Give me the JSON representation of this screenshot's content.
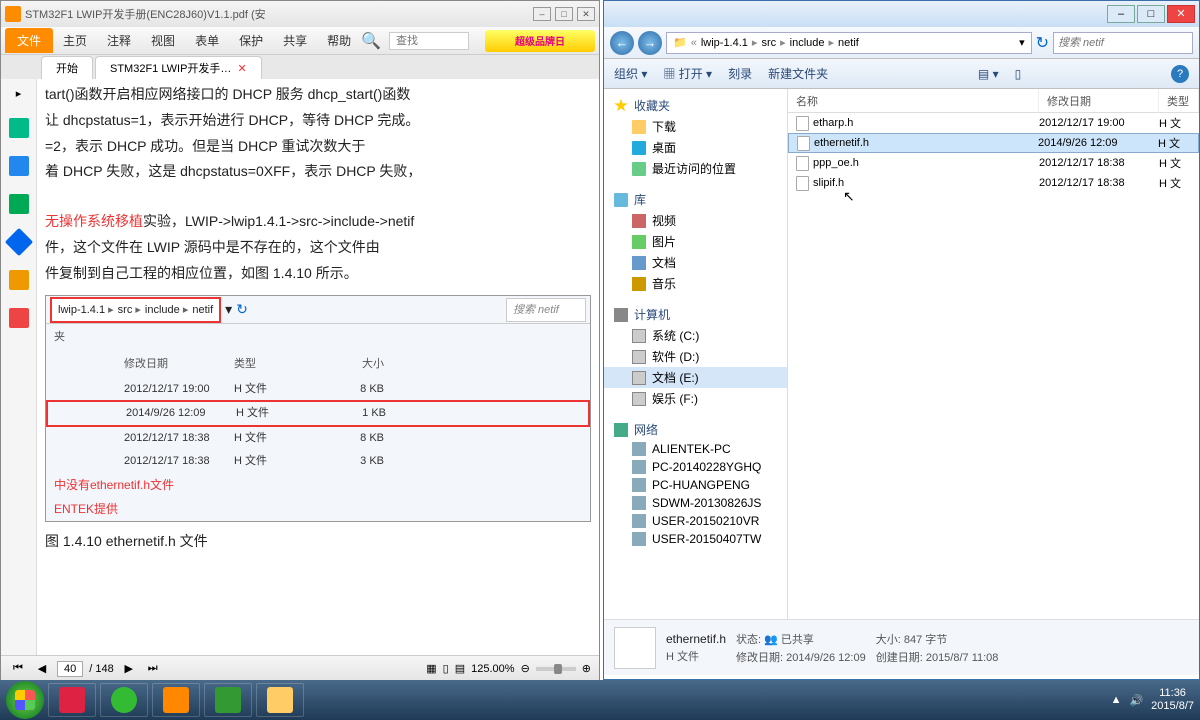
{
  "pdf": {
    "title": "STM32F1 LWIP开发手册(ENC28J60)V1.1.pdf (安",
    "menu": {
      "file": "文件",
      "home": "主页",
      "comment": "注释",
      "view": "视图",
      "form": "表单",
      "protect": "保护",
      "share": "共享",
      "help": "帮助"
    },
    "search_placeholder": "查找",
    "promo": "超级品牌日",
    "tabs": {
      "start": "开始",
      "doc": "STM32F1 LWIP开发手…"
    },
    "content": {
      "p1": "tart()函数开启相应网络接口的 DHCP 服务 dhcp_start()函数",
      "p2": "让 dhcpstatus=1，表示开始进行 DHCP，等待 DHCP 完成。",
      "p3": "=2，表示 DHCP 成功。但是当 DHCP 重试次数大于",
      "p4": "着 DHCP 失败，这是 dhcpstatus=0XFF，表示 DHCP 失败，",
      "p5a": "无操作系统移植",
      "p5b": "实验，LWIP->lwip1.4.1->src->include->netif",
      "p6": "件，这个文件在 LWIP 源码中是不存在的，这个文件由",
      "p7": "件复制到自己工程的相应位置，如图 1.4.10 所示。",
      "note1": "中没有ethernetif.h文件",
      "note2": "ENTEK提供",
      "caption": "图 1.4.10 ethernetif.h 文件"
    },
    "preview": {
      "crumbs": [
        "lwip-1.4.1",
        "src",
        "include",
        "netif"
      ],
      "search": "搜索 netif",
      "folder_label": "夹",
      "headers": {
        "date": "修改日期",
        "type": "类型",
        "size": "大小"
      },
      "rows": [
        {
          "date": "2012/12/17 19:00",
          "type": "H 文件",
          "size": "8 KB"
        },
        {
          "date": "2014/9/26 12:09",
          "type": "H 文件",
          "size": "1 KB"
        },
        {
          "date": "2012/12/17 18:38",
          "type": "H 文件",
          "size": "8 KB"
        },
        {
          "date": "2012/12/17 18:38",
          "type": "H 文件",
          "size": "3 KB"
        }
      ]
    },
    "status": {
      "page_current": "40",
      "page_total": "/ 148",
      "zoom": "125.00%"
    }
  },
  "explorer": {
    "nav": {
      "crumbs": [
        "lwip-1.4.1",
        "src",
        "include",
        "netif"
      ],
      "search": "搜索 netif"
    },
    "toolbar": {
      "organize": "组织 ▾",
      "open": "打开 ▾",
      "burn": "刻录",
      "newfolder": "新建文件夹"
    },
    "tree": {
      "favorites": "收藏夹",
      "downloads": "下载",
      "desktop": "桌面",
      "recent": "最近访问的位置",
      "library": "库",
      "video": "视频",
      "pictures": "图片",
      "documents": "文档",
      "music": "音乐",
      "computer": "计算机",
      "sysc": "系统 (C:)",
      "softd": "软件 (D:)",
      "doce": "文档 (E:)",
      "entf": "娱乐 (F:)",
      "network": "网络",
      "h1": "ALIENTEK-PC",
      "h2": "PC-20140228YGHQ",
      "h3": "PC-HUANGPENG",
      "h4": "SDWM-20130826JS",
      "h5": "USER-20150210VR",
      "h6": "USER-20150407TW"
    },
    "list": {
      "headers": {
        "name": "名称",
        "date": "修改日期",
        "type": "类型"
      },
      "rows": [
        {
          "name": "etharp.h",
          "date": "2012/12/17 19:00",
          "type": "H 文"
        },
        {
          "name": "ethernetif.h",
          "date": "2014/9/26 12:09",
          "type": "H 文"
        },
        {
          "name": "ppp_oe.h",
          "date": "2012/12/17 18:38",
          "type": "H 文"
        },
        {
          "name": "slipif.h",
          "date": "2012/12/17 18:38",
          "type": "H 文"
        }
      ]
    },
    "details": {
      "filename": "ethernetif.h",
      "filetype": "H 文件",
      "status_label": "状态:",
      "status_value": "已共享",
      "date_label": "修改日期:",
      "date_value": "2014/9/26 12:09",
      "size_label": "大小:",
      "size_value": "847 字节",
      "created_label": "创建日期:",
      "created_value": "2015/8/7 11:08"
    }
  },
  "taskbar": {
    "time": "11:36",
    "date": "2015/8/7"
  }
}
